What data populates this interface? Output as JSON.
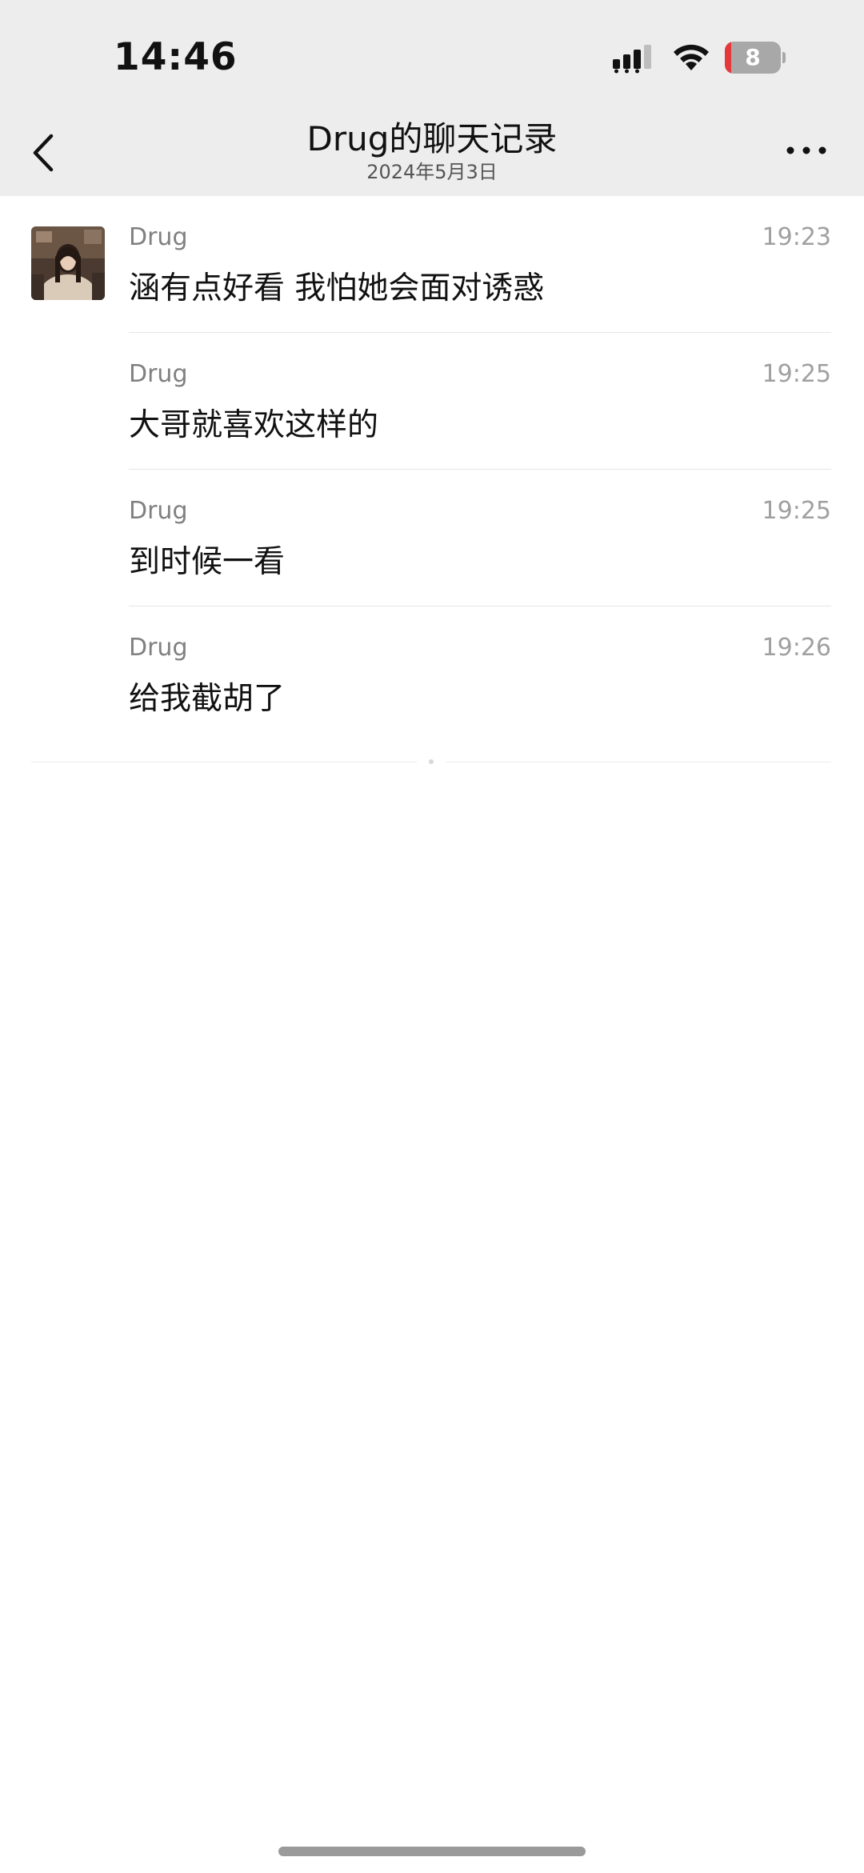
{
  "status_bar": {
    "time": "14:46",
    "battery_level": "8",
    "battery_percent": 8,
    "icons": [
      "signal-icon",
      "wifi-icon",
      "battery-icon"
    ]
  },
  "nav": {
    "title": "Drug的聊天记录",
    "subtitle": "2024年5月3日",
    "back_icon": "chevron-left-icon",
    "more_icon": "more-horizontal-icon"
  },
  "messages": [
    {
      "sender": "Drug",
      "time": "19:23",
      "text": "涵有点好看 我怕她会面对诱惑",
      "show_avatar": true
    },
    {
      "sender": "Drug",
      "time": "19:25",
      "text": "大哥就喜欢这样的",
      "show_avatar": false
    },
    {
      "sender": "Drug",
      "time": "19:25",
      "text": "到时候一看",
      "show_avatar": false
    },
    {
      "sender": "Drug",
      "time": "19:26",
      "text": "给我截胡了",
      "show_avatar": false
    }
  ],
  "colors": {
    "header_bg": "#ededed",
    "page_bg": "#ffffff",
    "battery_low": "#e5383b",
    "text_primary": "#111111",
    "text_secondary": "#808080"
  }
}
